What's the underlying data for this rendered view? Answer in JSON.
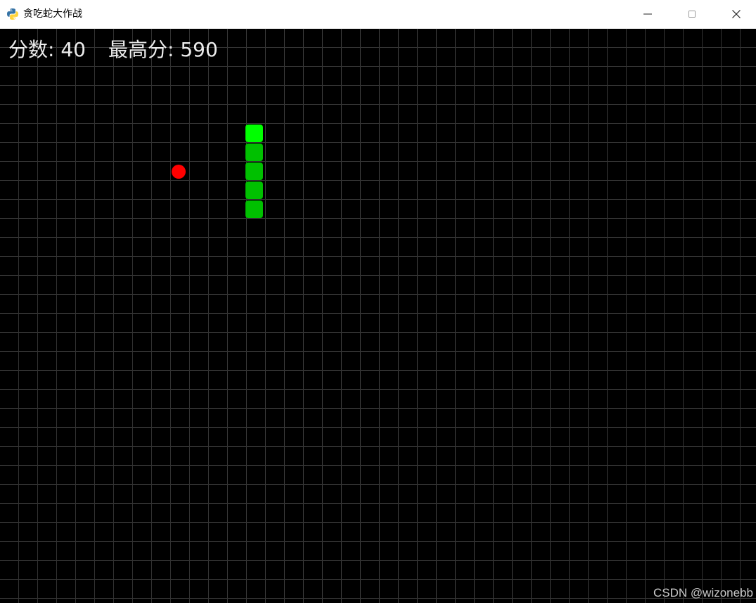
{
  "window": {
    "title": "贪吃蛇大作战",
    "app_icon": "python-icon",
    "controls": [
      "minimize-icon",
      "maximize-icon",
      "close-icon"
    ]
  },
  "hud": {
    "score_label": "分数:",
    "score": "40",
    "high_score_label": "最高分:",
    "high_score": "590"
  },
  "game": {
    "background_color": "#000000",
    "grid_color": "#333333",
    "snake_head_color": "#00ff00",
    "snake_body_color": "#00c000",
    "food_color": "#ff0000",
    "snake_length": 5
  },
  "watermark": "CSDN @wizonebb"
}
